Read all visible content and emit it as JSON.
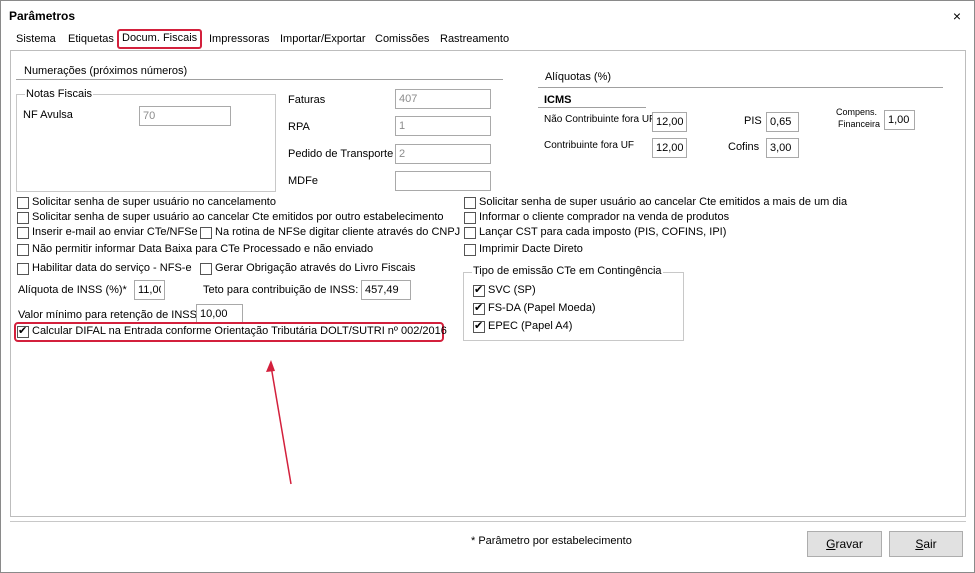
{
  "window": {
    "title": "Parâmetros",
    "close_glyph": "×"
  },
  "tabs": [
    "Sistema",
    "Etiquetas",
    "Docum. Fiscais",
    "Impressoras",
    "Importar/Exportar",
    "Comissões",
    "Rastreamento"
  ],
  "numeracoes": {
    "title": "Numerações (próximos números)",
    "notas_fiscais": {
      "title": "Notas Fiscais",
      "nf_avulsa_label": "NF Avulsa",
      "nf_avulsa_value": "70"
    },
    "faturas_label": "Faturas",
    "faturas_value": "407",
    "rpa_label": "RPA",
    "rpa_value": "1",
    "pedido_label": "Pedido de Transporte",
    "pedido_value": "2",
    "mdfe_label": "MDFe",
    "mdfe_value": ""
  },
  "aliquotas": {
    "title": "Alíquotas (%)",
    "icms_title": "ICMS",
    "nao_contribuinte_label": "Não Contribuinte fora UF",
    "nao_contribuinte_value": "12,00",
    "contribuinte_label": "Contribuinte fora UF",
    "contribuinte_value": "12,00",
    "pis_label": "PIS",
    "pis_value": "0,65",
    "cofins_label": "Cofins",
    "cofins_value": "3,00",
    "compens_label_1": "Compens.",
    "compens_label_2": "Financeira",
    "compens_value": "1,00"
  },
  "options_left": {
    "senha_cancelamento": "Solicitar senha de super usuário no cancelamento",
    "senha_outro_estab": "Solicitar senha de super usuário ao cancelar Cte emitidos por outro estabelecimento",
    "inserir_email": "Inserir e-mail ao enviar CTe/NFSe",
    "rotina_nfse": "Na rotina de NFSe digitar cliente através do CNPJ",
    "nao_permitir_baixa": "Não permitir informar Data Baixa para CTe Processado e não enviado",
    "habilitar_data_servico": "Habilitar data do serviço - NFS-e",
    "gerar_obrigacao": "Gerar Obrigação através do Livro Fiscais",
    "aliquota_inss_label": "Alíquota de INSS (%)*",
    "aliquota_inss_value": "11,00",
    "teto_label": "Teto para contribuição de  INSS:",
    "teto_value": "457,49",
    "valor_minimo_label": "Valor mínimo para retenção de INSS",
    "valor_minimo_value": "10,00",
    "calcular_difal": "Calcular DIFAL na Entrada conforme Orientação Tributária DOLT/SUTRI nº 002/2016"
  },
  "options_right": {
    "senha_mais_de_um_dia": "Solicitar senha de super usuário ao cancelar Cte emitidos a mais de um dia",
    "informar_comprador": "Informar o cliente comprador na venda de produtos",
    "lancar_cst": "Lançar CST para cada imposto (PIS, COFINS, IPI)",
    "imprimir_dacte": "Imprimir Dacte Direto"
  },
  "contingencia": {
    "title": "Tipo de emissão CTe em Contingência",
    "options": [
      "SVC (SP)",
      "FS-DA (Papel Moeda)",
      "EPEC (Papel A4)"
    ]
  },
  "footer": {
    "note": "* Parâmetro por estabelecimento",
    "gravar_underline": "G",
    "gravar_rest": "ravar",
    "sair_underline": "S",
    "sair_rest": "air"
  },
  "colors": {
    "highlight": "#d3203c",
    "panel_border": "#bdbdbd"
  }
}
